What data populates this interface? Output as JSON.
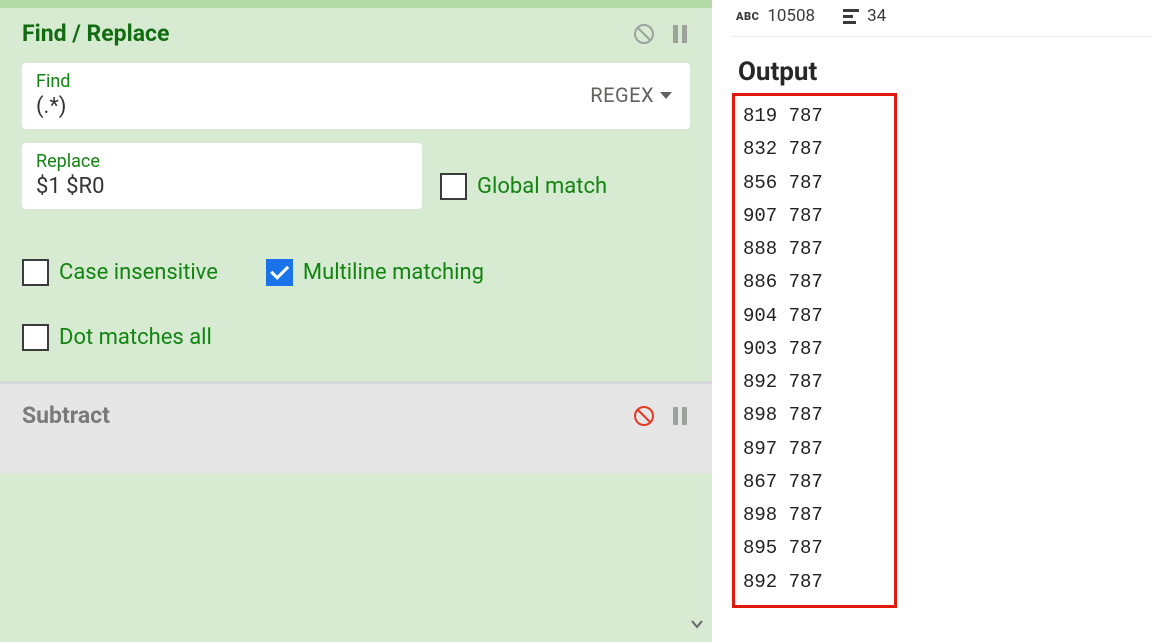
{
  "findReplace": {
    "title": "Find / Replace",
    "find_label": "Find",
    "find_value": "(.*)",
    "regex_label": "REGEX",
    "replace_label": "Replace",
    "replace_value": "$1 $R0",
    "global_match_label": "Global match",
    "case_insensitive_label": "Case insensitive",
    "multiline_label": "Multiline matching",
    "dot_matches_label": "Dot matches all",
    "global_match_checked": false,
    "case_insensitive_checked": false,
    "multiline_checked": true,
    "dot_matches_checked": false
  },
  "subtract": {
    "title": "Subtract"
  },
  "stats": {
    "chars": "10508",
    "lines": "34"
  },
  "output": {
    "title": "Output",
    "lines": [
      "819 787",
      "832 787",
      "856 787",
      "907 787",
      "888 787",
      "886 787",
      "904 787",
      "903 787",
      "892 787",
      "898 787",
      "897 787",
      "867 787",
      "898 787",
      "895 787",
      "892 787"
    ]
  }
}
